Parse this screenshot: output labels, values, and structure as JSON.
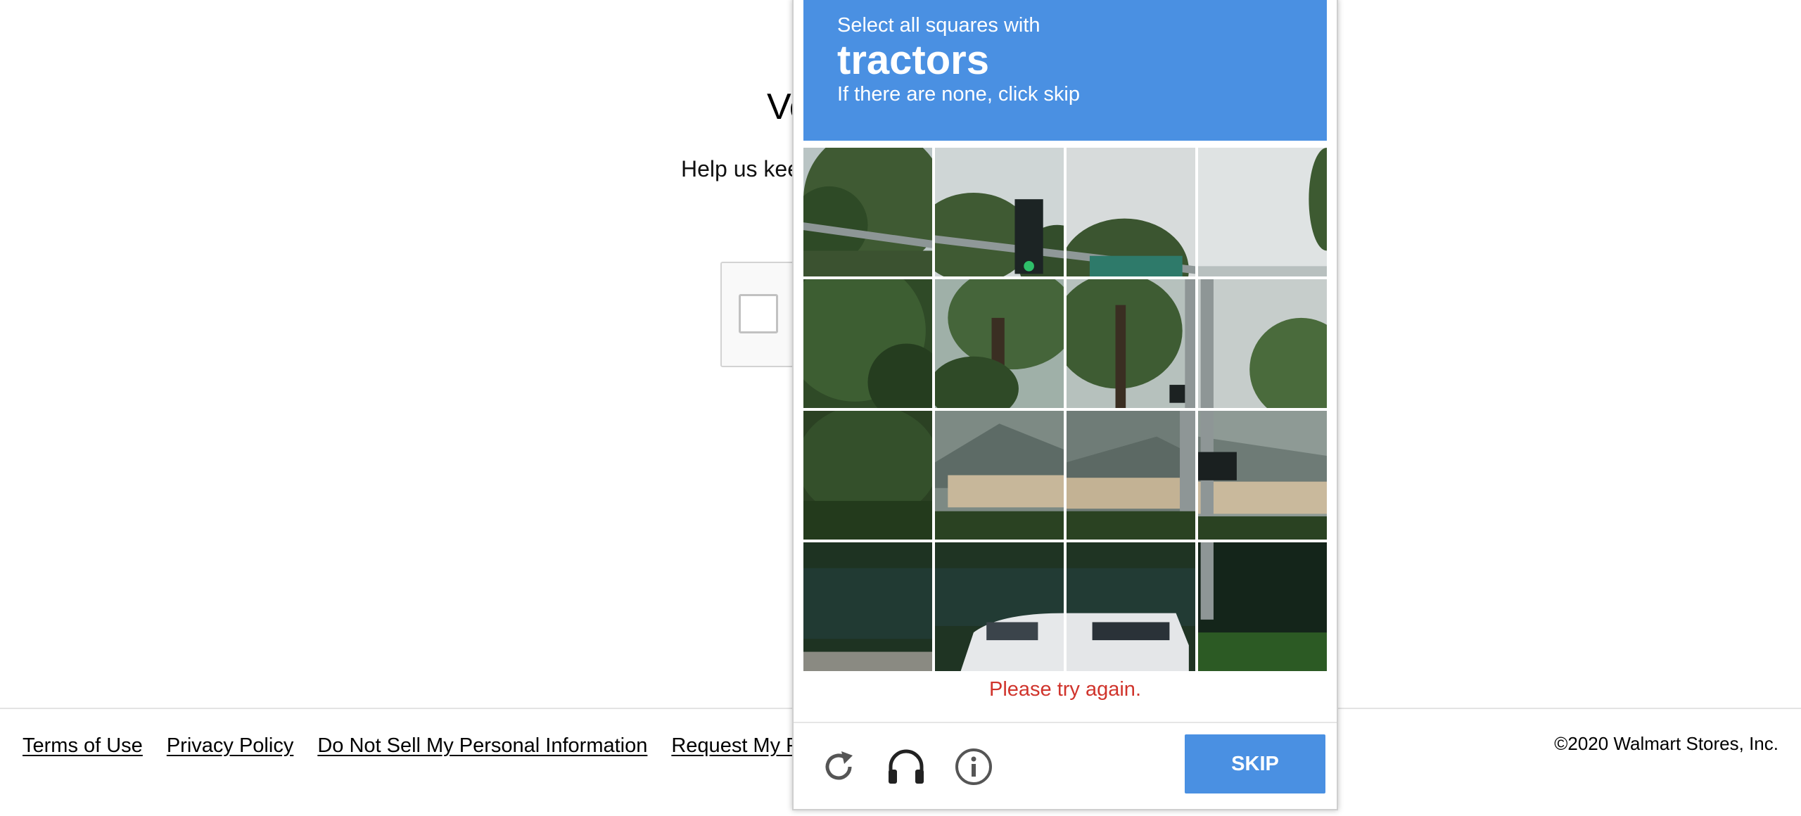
{
  "page": {
    "title": "Ve",
    "subtitle": "Help us kee"
  },
  "footer": {
    "links": [
      "Terms of Use",
      "Privacy Policy",
      "Do Not Sell My Personal Information",
      "Request My Perso"
    ],
    "copyright": "©2020 Walmart Stores, Inc."
  },
  "challenge": {
    "instruction": "Select all squares with",
    "keyword": "tractors",
    "hint": "If there are none, click skip",
    "error": "Please try again.",
    "skip_label": "SKIP",
    "accent_color": "#4a90e2",
    "error_color": "#d0342c",
    "grid_size": "4x4",
    "icons": [
      "reload-icon",
      "headphones-icon",
      "info-icon"
    ]
  }
}
